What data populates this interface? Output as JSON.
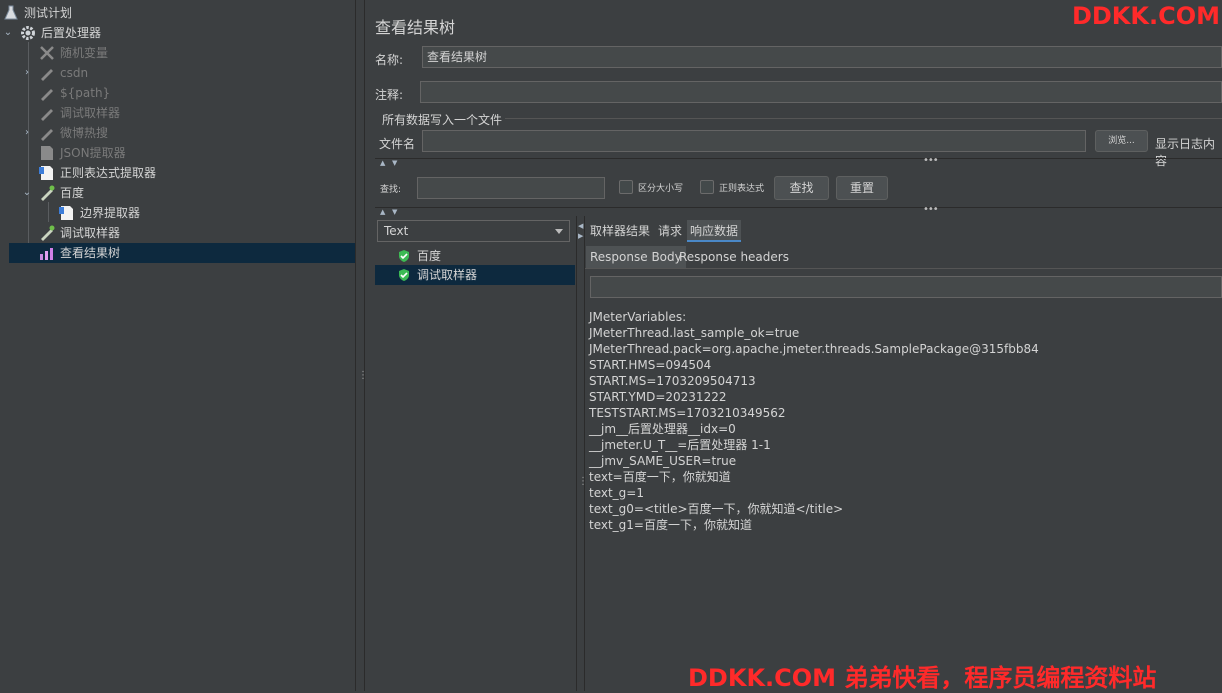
{
  "tree": {
    "items": [
      {
        "label": "测试计划",
        "icon": "flask-icon"
      },
      {
        "label": "后置处理器",
        "icon": "gear-icon"
      },
      {
        "label": "随机变量",
        "icon": "wrench-icon"
      },
      {
        "label": "csdn",
        "icon": "pipette-icon"
      },
      {
        "label": "${path}",
        "icon": "pipette-icon"
      },
      {
        "label": "调试取样器",
        "icon": "pipette-icon"
      },
      {
        "label": "微博热搜",
        "icon": "pipette-icon"
      },
      {
        "label": "JSON提取器",
        "icon": "document-icon"
      },
      {
        "label": "正则表达式提取器",
        "icon": "document-icon"
      },
      {
        "label": "百度",
        "icon": "pipette-icon"
      },
      {
        "label": "边界提取器",
        "icon": "document-icon"
      },
      {
        "label": "调试取样器",
        "icon": "pipette-icon"
      },
      {
        "label": "查看结果树",
        "icon": "chart-icon"
      }
    ]
  },
  "panel": {
    "title": "查看结果树",
    "name_label": "名称:",
    "name_value": "查看结果树",
    "comment_label": "注释:",
    "comment_value": "",
    "file_section_label": "所有数据写入一个文件",
    "filename_label": "文件名",
    "filename_value": "",
    "browse_label": "浏览...",
    "log_content_label": "显示日志内容"
  },
  "search": {
    "label": "查找:",
    "value": "",
    "case_sensitive_label": "区分大小写",
    "regex_label": "正则表达式",
    "find_button": "查找",
    "reset_button": "重置"
  },
  "results": {
    "renderer": "Text",
    "samples": [
      {
        "label": "百度",
        "status": "success"
      },
      {
        "label": "调试取样器",
        "status": "success"
      }
    ]
  },
  "tabs": {
    "sampler_result": "取样器结果",
    "request": "请求",
    "response_data": "响应数据",
    "response_body": "Response Body",
    "response_headers": "Response headers"
  },
  "response": {
    "lines": [
      "JMeterVariables:",
      "JMeterThread.last_sample_ok=true",
      "JMeterThread.pack=org.apache.jmeter.threads.SamplePackage@315fbb84",
      "START.HMS=094504",
      "START.MS=1703209504713",
      "START.YMD=20231222",
      "TESTSTART.MS=1703210349562",
      "__jm__后置处理器__idx=0",
      "__jmeter.U_T__=后置处理器 1-1",
      "__jmv_SAME_USER=true",
      "text=百度一下，你就知道",
      "text_g=1",
      "text_g0=<title>百度一下，你就知道</title>",
      "text_g1=百度一下，你就知道"
    ]
  },
  "watermark": {
    "top": "DDKK.COM",
    "bottom": "DDKK.COM 弟弟快看，程序员编程资料站"
  }
}
